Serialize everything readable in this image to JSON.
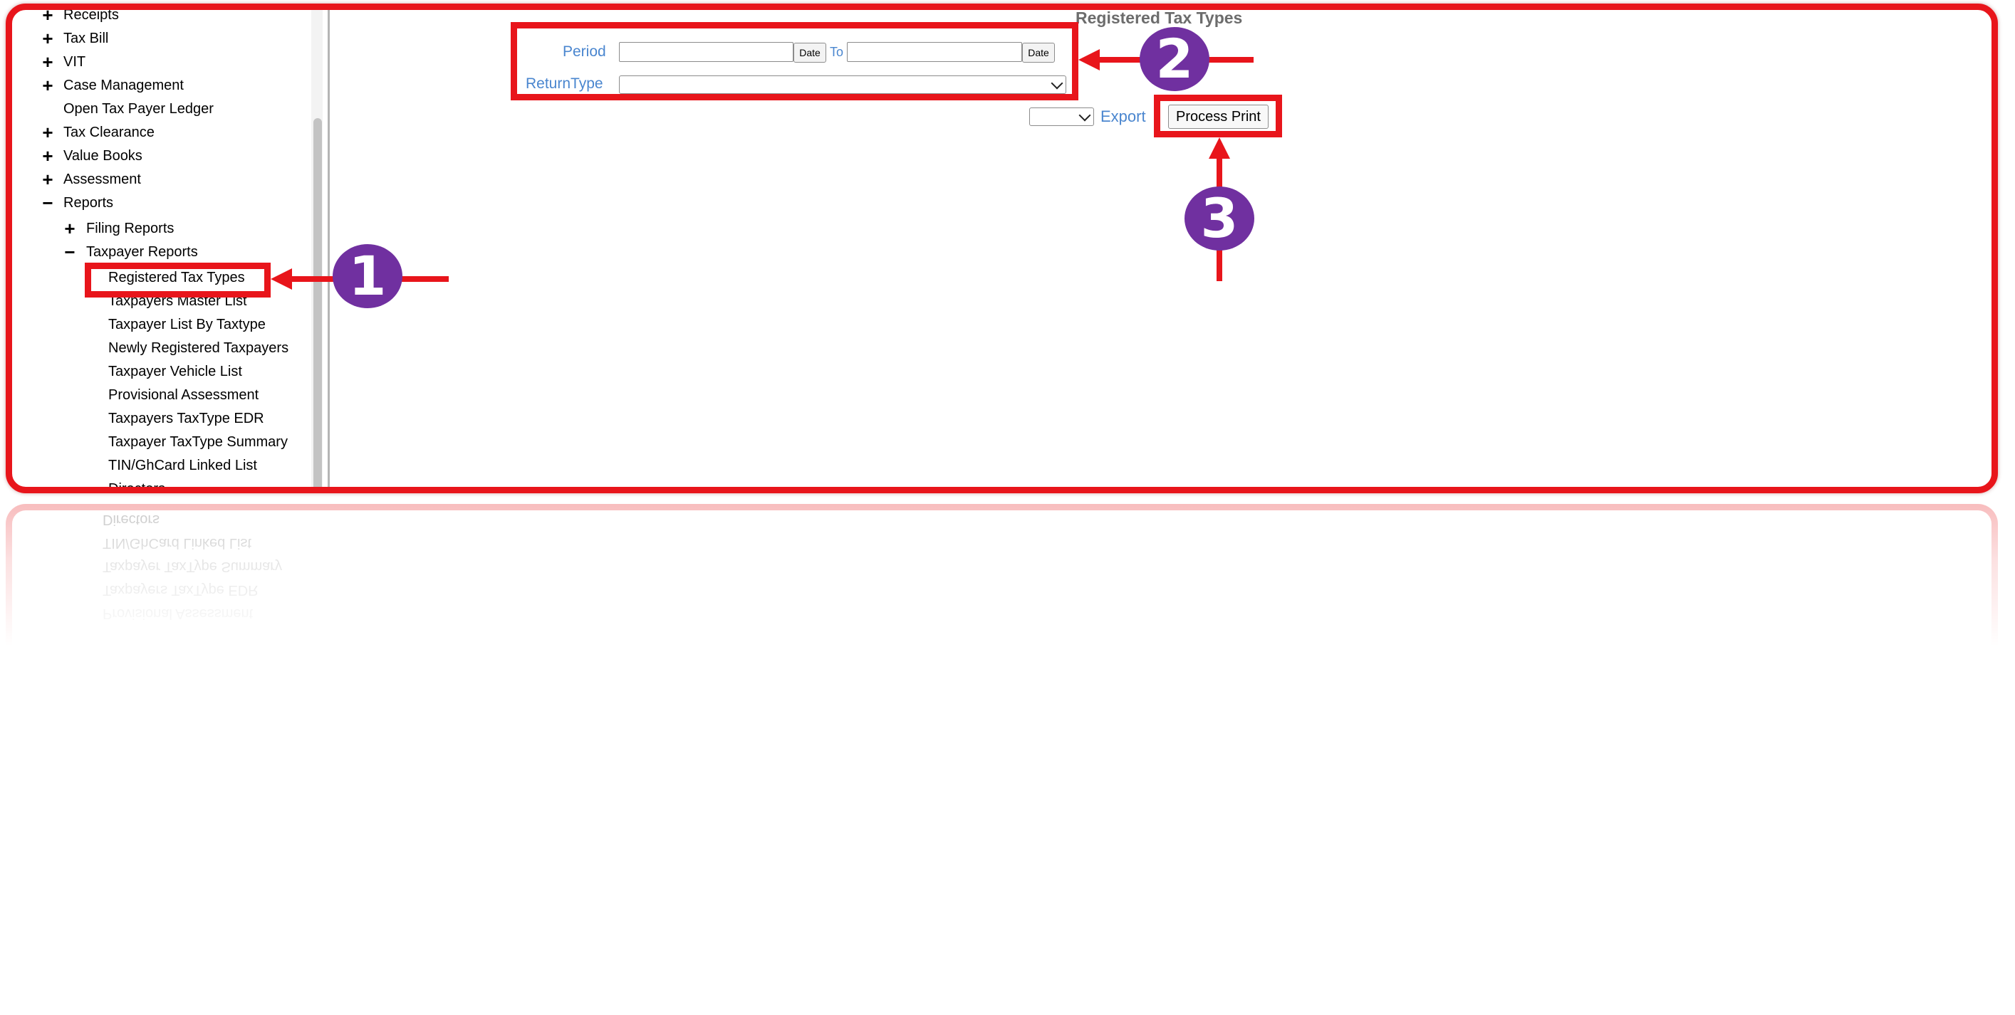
{
  "tree": {
    "items": [
      {
        "label": "Receipts",
        "toggle": "+"
      },
      {
        "label": "Tax Bill",
        "toggle": "+"
      },
      {
        "label": "VIT",
        "toggle": "+"
      },
      {
        "label": "Case Management",
        "toggle": "+"
      },
      {
        "label": "Open Tax Payer Ledger",
        "toggle": ""
      },
      {
        "label": "Tax Clearance",
        "toggle": "+"
      },
      {
        "label": "Value Books",
        "toggle": "+"
      },
      {
        "label": "Assessment",
        "toggle": "+"
      },
      {
        "label": "Reports",
        "toggle": "−"
      }
    ],
    "reports_children": [
      {
        "label": "Filing Reports",
        "toggle": "+"
      },
      {
        "label": "Taxpayer Reports",
        "toggle": "−"
      }
    ],
    "taxpayer_reports": [
      "Registered Tax Types",
      "Taxpayers Master List",
      "Taxpayer List By Taxtype",
      "Newly Registered Taxpayers",
      "Taxpayer Vehicle List",
      "Provisional Assessment",
      "Taxpayers TaxType EDR",
      "Taxpayer TaxType Summary",
      "TIN/GhCard Linked List",
      "Directors"
    ]
  },
  "content": {
    "title": "Registered Tax Types",
    "period_label": "Period",
    "date_button": "Date",
    "to_label": "To",
    "period_from_value": "",
    "period_to_value": "",
    "return_type_label": "ReturnType",
    "return_type_value": "",
    "export_select_value": "",
    "export_label": "Export",
    "process_print_label": "Process Print"
  },
  "annotations": {
    "badges": [
      "1",
      "2",
      "3"
    ],
    "color_red": "#e8151b",
    "color_purple": "#7030a0"
  }
}
